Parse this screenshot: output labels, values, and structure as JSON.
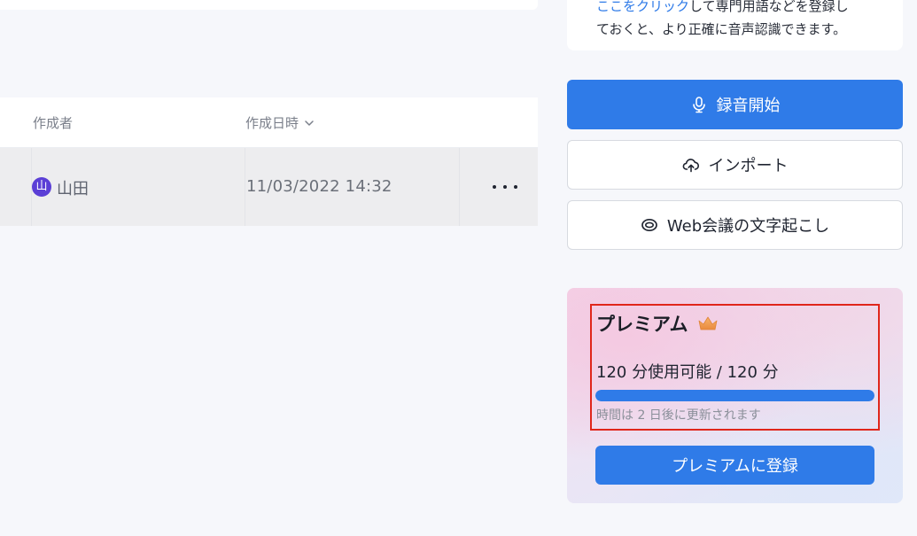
{
  "info_card": {
    "line1_link": "ここをクリック",
    "line1_rest": "して専門用語などを登録し",
    "line2": "ておくと、より正確に音声認識できます。"
  },
  "table": {
    "headers": {
      "creator": "作成者",
      "created_at": "作成日時"
    },
    "rows": [
      {
        "avatar_initial": "山",
        "author": "山田",
        "date": "11/03/2022 14:32"
      }
    ]
  },
  "actions": {
    "record": {
      "label": "録音開始",
      "icon": "microphone-icon"
    },
    "import": {
      "label": "インポート",
      "icon": "cloud-upload-icon"
    },
    "web": {
      "label": "Web会議の文字起こし",
      "icon": "web-meeting-icon"
    }
  },
  "premium": {
    "title": "プレミアム",
    "usage": "120 分使用可能 / 120 分",
    "usage_fraction": 1.0,
    "renew": "時間は 2 日後に更新されます",
    "subscribe_label": "プレミアムに登録"
  },
  "colors": {
    "accent": "#2f7be8",
    "avatar": "#5b3fd6",
    "highlight": "#e0261b"
  }
}
